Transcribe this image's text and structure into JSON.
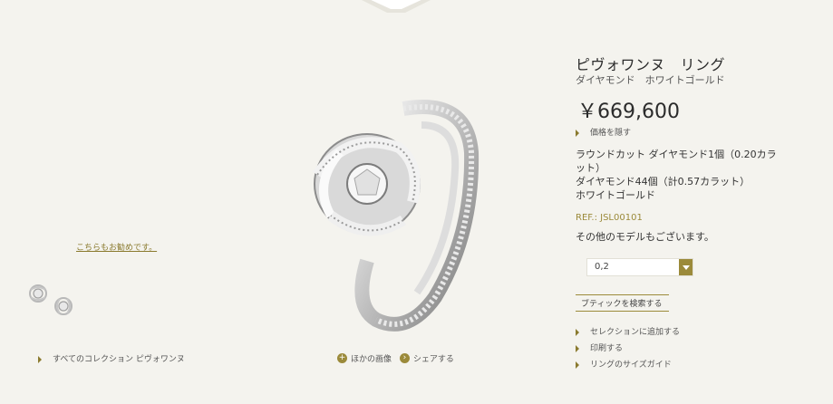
{
  "recommend": {
    "label": "こちらもお勧めです。"
  },
  "breadcrumb": {
    "all_collection": "すべてのコレクション ピヴォワンヌ"
  },
  "media": {
    "more_images": "ほかの画像",
    "share": "シェアする"
  },
  "product": {
    "title": "ピヴォワンヌ　リング",
    "subtitle": "ダイヤモンド　ホワイトゴールド",
    "price": "￥669,600",
    "hide_price": "価格を隠す",
    "description": [
      "ラウンドカット ダイヤモンド1個（0.20カラット）",
      "ダイヤモンド44個（計0.57カラット）",
      "ホワイトゴールド"
    ],
    "ref": "REF.: JSL00101",
    "other_models": "その他のモデルもございます。",
    "size_value": "0,2",
    "boutique_button": "ブティックを検索する"
  },
  "links": {
    "add_selection": "セレクションに追加する",
    "print": "印刷する",
    "size_guide": "リングのサイズガイド"
  },
  "colors": {
    "accent": "#9b8a3a",
    "background": "#f4f3ee"
  }
}
